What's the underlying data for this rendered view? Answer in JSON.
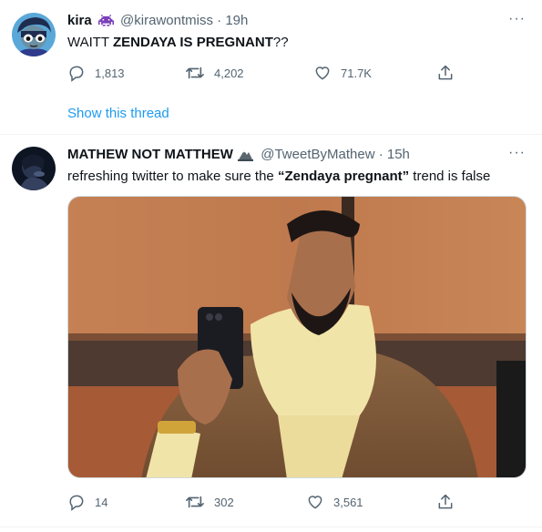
{
  "tweet1": {
    "name": "kira",
    "handle": "@kirawontmiss",
    "time": "19h",
    "text_pre": "WAITT ",
    "text_bold": "ZENDAYA IS PREGNANT",
    "text_post": "??",
    "replies": "1,813",
    "retweets": "4,202",
    "likes": "71.7K",
    "show_thread": "Show this thread"
  },
  "tweet2": {
    "name": "MATHEW NOT MATTHEW",
    "handle": "@TweetByMathew",
    "time": "15h",
    "text_pre": "refreshing twitter to make sure the ",
    "text_bold": "“Zendaya pregnant”",
    "text_post": " trend is false",
    "replies": "14",
    "retweets": "302",
    "likes": "3,561"
  },
  "separator": " · ",
  "more_glyph": "···",
  "colors": {
    "link": "#1d9bf0",
    "muted": "#536471",
    "text": "#0f1419"
  },
  "icons": [
    "reply-icon",
    "retweet-icon",
    "like-icon",
    "share-icon",
    "more-icon",
    "space-invader-emoji",
    "mountain-emoji"
  ]
}
